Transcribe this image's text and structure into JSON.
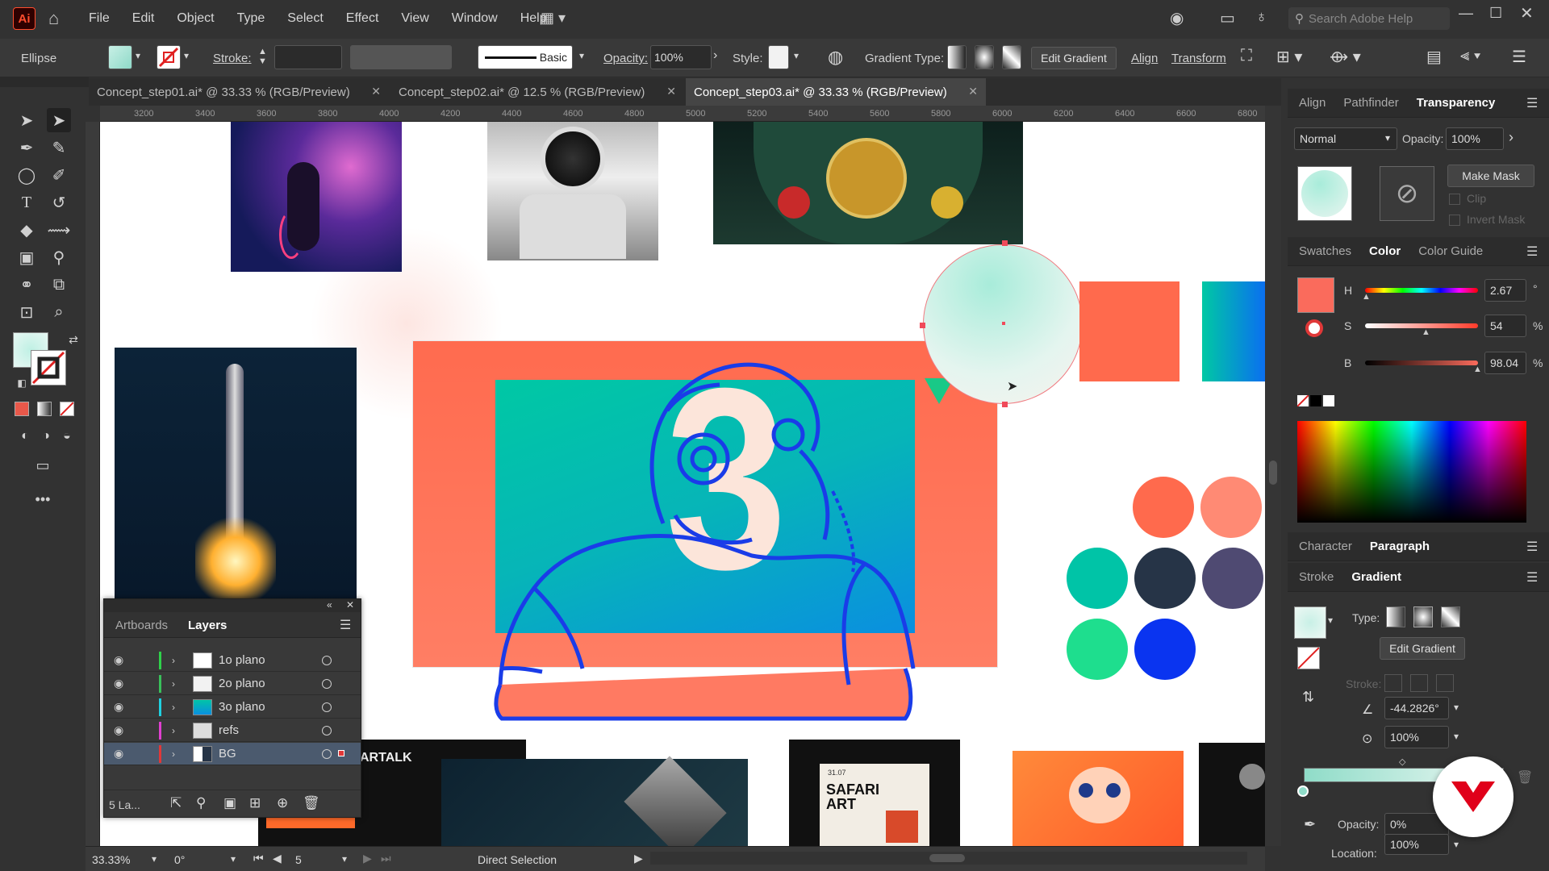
{
  "app": {
    "logo": "Ai"
  },
  "menu": [
    "File",
    "Edit",
    "Object",
    "Type",
    "Select",
    "Effect",
    "View",
    "Window",
    "Help"
  ],
  "search": {
    "placeholder": "Search Adobe Help"
  },
  "control": {
    "object": "Ellipse",
    "stroke_label": "Stroke:",
    "brush": "Basic",
    "opacity_label": "Opacity:",
    "opacity_value": "100%",
    "style_label": "Style:",
    "gradient_type_label": "Gradient Type:",
    "edit_gradient": "Edit Gradient",
    "align": "Align",
    "transform": "Transform"
  },
  "tabs": [
    {
      "label": "Concept_step01.ai* @ 33.33 % (RGB/Preview)"
    },
    {
      "label": "Concept_step02.ai* @ 12.5 % (RGB/Preview)"
    },
    {
      "label": "Concept_step03.ai* @ 33.33 % (RGB/Preview)",
      "active": true
    }
  ],
  "ruler_ticks": [
    "3200",
    "3400",
    "3600",
    "3800",
    "4000",
    "4200",
    "4400",
    "4600",
    "4800",
    "5000",
    "5200",
    "5400",
    "5600",
    "5800",
    "6000",
    "6200",
    "6400",
    "6600",
    "6800"
  ],
  "canvas": {
    "hero_number": "3",
    "artalk_text": "ARTALK",
    "poster_date": "31.07",
    "poster_title_1": "SAFARI",
    "poster_title_2": "ART",
    "colors": {
      "coral": "#ff6a4d",
      "salmon": "#ff8a74",
      "teal": "#00c4a7",
      "navy": "#263447",
      "purple": "#4f4a72",
      "green": "#1ede8e",
      "blue": "#0a34f0",
      "line_blue": "#1a3ce8"
    }
  },
  "layers_panel": {
    "tabs": [
      "Artboards",
      "Layers"
    ],
    "rows": [
      {
        "name": "1o plano",
        "color": "#2fd14a"
      },
      {
        "name": "2o plano",
        "color": "#39c05a"
      },
      {
        "name": "3o plano",
        "color": "#1fd0e0"
      },
      {
        "name": "refs",
        "color": "#e040d0"
      },
      {
        "name": "BG",
        "color": "#e03838",
        "selected": true
      }
    ],
    "footer": "5 La..."
  },
  "right": {
    "top_tabs": [
      "Align",
      "Pathfinder",
      "Transparency"
    ],
    "blend_mode": "Normal",
    "opacity_label": "Opacity:",
    "opacity_value": "100%",
    "make_mask": "Make Mask",
    "clip": "Clip",
    "invert_mask": "Invert Mask",
    "color_tabs": [
      "Swatches",
      "Color",
      "Color Guide"
    ],
    "h_label": "H",
    "h_value": "2.67",
    "h_unit": "°",
    "s_label": "S",
    "s_value": "54",
    "s_unit": "%",
    "b_label": "B",
    "b_value": "98.04",
    "b_unit": "%",
    "char_tabs": [
      "Character",
      "Paragraph"
    ],
    "grad_tabs": [
      "Stroke",
      "Gradient"
    ],
    "type_label": "Type:",
    "edit_gradient": "Edit Gradient",
    "stroke_label": "Stroke:",
    "angle_value": "-44.2826°",
    "aspect_value": "100%",
    "stop_opacity_label": "Opacity:",
    "stop_opacity_value": "0%",
    "location_label": "Location:",
    "location_value": "100%"
  },
  "status": {
    "zoom": "33.33%",
    "rotation": "0°",
    "artboard": "5",
    "tool": "Direct Selection"
  }
}
